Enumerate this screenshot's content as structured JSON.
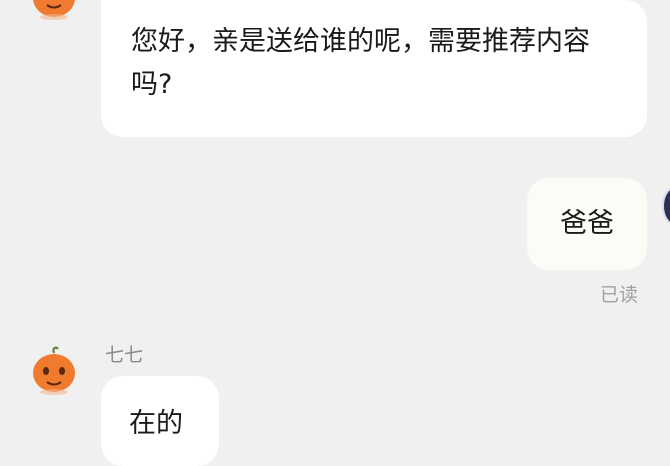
{
  "messages": {
    "incoming_1": {
      "text": "您好，亲是送给谁的呢，需要推荐内容吗?"
    },
    "outgoing_1": {
      "text": "爸爸",
      "status": "已读"
    },
    "incoming_2": {
      "sender": "七七",
      "text": "在的"
    }
  },
  "icons": {
    "agent_avatar": "orange-mascot-avatar-icon",
    "self_avatar": "user-avatar-icon"
  },
  "colors": {
    "background": "#f0f0f0",
    "bubble": "#ffffff",
    "avatar_orange": "#f07a2e",
    "read_receipt": "#a0a0a0"
  }
}
